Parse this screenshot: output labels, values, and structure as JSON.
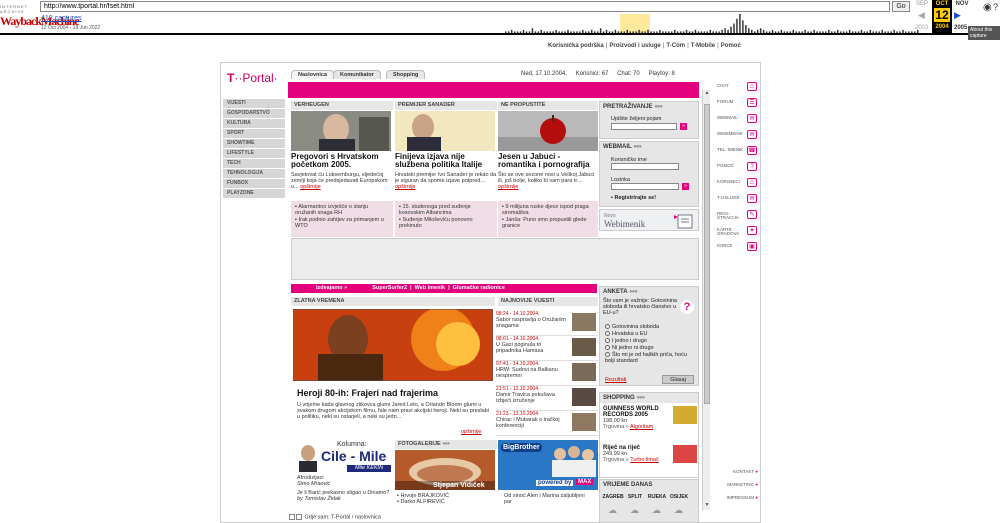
{
  "wayback": {
    "brand_small": "INTERNET ARCHIVE",
    "brand_big_a": "Wayback",
    "brand_big_b": "Machine",
    "url": "http://www.tportal.hr/fset.html",
    "go_label": "Go",
    "captures": "410 captures",
    "range": "12 Oct 2004 - 18 Jun 2022",
    "month_prev": "SEP",
    "month_cur": "OCT",
    "month_next": "NOV",
    "day": "12",
    "year_prev": "2003",
    "year_cur": "2004",
    "year_next": "2005",
    "about": "About this capture",
    "histogram": [
      1,
      1,
      2,
      1,
      1,
      1,
      2,
      1,
      1,
      3,
      1,
      1,
      2,
      1,
      1,
      1,
      1,
      2,
      1,
      1,
      1,
      2,
      1,
      1,
      1,
      1,
      2,
      1,
      1,
      2,
      1,
      1,
      3,
      1,
      2,
      1,
      1,
      2,
      1,
      1,
      1,
      2,
      1,
      1,
      1,
      2,
      1,
      1,
      2,
      1,
      1,
      1,
      2,
      1,
      1,
      1,
      1,
      2,
      1,
      1,
      1,
      2,
      1,
      1,
      2,
      1,
      1,
      1,
      1,
      2,
      1,
      1,
      1,
      2,
      3,
      2,
      4,
      6,
      9,
      12,
      8,
      5,
      3,
      2,
      1,
      2,
      3,
      2,
      1,
      1,
      2,
      1,
      1,
      2,
      1,
      1,
      1,
      2,
      1,
      1,
      1,
      2,
      1,
      1,
      2,
      1,
      1,
      1,
      1,
      2,
      1,
      1,
      2,
      1,
      1,
      1,
      2,
      1,
      1,
      1,
      2,
      1,
      1,
      2,
      1,
      1,
      1,
      2,
      1,
      1,
      1,
      2,
      1,
      1,
      2,
      1,
      1,
      1,
      1,
      2
    ]
  },
  "toplinks": [
    "Korisnička podrška",
    "Proizvodi i usluge",
    "T-Com",
    "T-Mobile",
    "Pomoć"
  ],
  "logo": {
    "t": "T",
    "rest": "··Portal·"
  },
  "tabs": [
    "Naslovnica",
    "Komunikator",
    "Shopping"
  ],
  "status": {
    "date": "Ned, 17.10.2004.",
    "korisnici": "Korisnici: 67",
    "chat": "Chat: 70",
    "playtoy": "Playtoy: 8"
  },
  "leftnav": [
    "VIJESTI",
    "GOSPODARSTVO",
    "KULTURA",
    "SPORT",
    "SHOWTIME",
    "LIFESTYLE",
    "TECH",
    "TEHNOLOGIJA",
    "FUNBOX",
    "PLAYZONE"
  ],
  "news": [
    {
      "head": "VERHEUGEN",
      "title": "Pregovori s Hrvatskom početkom 2005.",
      "text": "Savjetovat ću Luksemburgu, sljedećoj zemlji koja će predsjedavati Europskom u...",
      "more": "opširnije",
      "links": [
        "Alarmantno izvješće o stanju oružanih snaga RH",
        "Irak podnio zahtjev za primanjem u WTO"
      ]
    },
    {
      "head": "PREMIJER SANADER",
      "title": "Finijeva izjava nije službena politika Italije",
      "text": "Hrvatski premijer Ivo Sanader je rekao da je siguran da spome izjave potpred...",
      "more": "opširnije",
      "links": [
        "15. studenoga pred suđenje kosovskim Albancima",
        "Suđenje Miloševiću ponovno prekinuto"
      ]
    },
    {
      "head": "NE PROPUSTITE",
      "title": "Jesen u Jabuci - romantika i pornografija",
      "text": "Što se ove sezone nosi u Velikoj Jabuci ili, još bolje, koliko bi vam para tr...",
      "more": "opširnije",
      "links": [
        "9 milijuna ruske djece ispod praga siromaštva",
        "Janša: Puno smo propustili glede granice"
      ]
    }
  ],
  "search": {
    "head": "PRETRAŽIVANJE",
    "label": "Upišite željeni pojam",
    "go": "»"
  },
  "webmail": {
    "head": "WEBMAIL",
    "user_label": "Korisničko ime",
    "pass_label": "Lozinka",
    "register": "Registrirajte se!",
    "go": "»"
  },
  "webmenik": {
    "a": "Novo",
    "b": "Webimenik"
  },
  "pinkbar2": {
    "a": "Izdvajamo »",
    "b": "SuperSurfer2",
    "c": "Web imenik",
    "d": "Glumačke radionice",
    "sep": "|"
  },
  "zlatna": {
    "head": "ZLATNA VREMENA",
    "title": "Heroji 80-ih: Frajeri nad frajerima",
    "text": "U vrijeme kada glavnog zlikovca glumi Jared Leto, a Orlando Bloom glumi u svakom drugom akcijskom filmu, fale nam pravi akcijski heroji. Neki su preslabi u politiku, neki su ostarjeli, a neki su jedn...",
    "more": "opširnije"
  },
  "najnovije": {
    "head": "NAJNOVIJE VIJESTI",
    "items": [
      {
        "date": "08:24 - 14.10.2004.",
        "text": "Sabor raspravlja o Oružanim snagama"
      },
      {
        "date": "08:01 - 14.10.2004.",
        "text": "U Gazi poginula tri pripadnika Hamasa"
      },
      {
        "date": "07:41 - 14.10.2004.",
        "text": "HRW: Sudovi na Balkanu nespremni"
      },
      {
        "date": "21:51 - 13.10.2004.",
        "text": "Damir Travica pokušava izbjeći izručenje"
      },
      {
        "date": "21:23 - 13.10.2004.",
        "text": "Chirac i Mubarak o iračkoj konferenciji"
      }
    ]
  },
  "kolumna": {
    "label": "Kolumna:",
    "name": "Cile - Mile",
    "author": "Mile KEKIN",
    "t1": "Afrodizijaci",
    "t1b": "Simo Mraović",
    "t2": "Je li Barić prekasno stigao u Dinamo?",
    "t2b": "by Tomislav Židak"
  },
  "fotogal": {
    "head": "FOTOGALERIJE",
    "caption": "Stjepan Vidiček",
    "items": [
      "Hrvoje BRAJKOVIĆ",
      "Darko ALFIREVIĆ"
    ]
  },
  "bigbrother": {
    "logo": "BigBrother",
    "powered": "powered by",
    "max": "MAX",
    "text": "Od sinoć Alen i Marina zaljubljeni par"
  },
  "anketa": {
    "head": "ANKETA",
    "question": "Što vam je važnije: Gotovinina sloboda ili hrvatsko članstvo u EU-u?",
    "options": [
      "Gotovinina sloboda",
      "Hrvatska u EU",
      "I jedno i drugo",
      "Ni jedno ni drugo",
      "Što mi je od haških priča, hoću bolji standard"
    ],
    "results": "Rezultati",
    "vote": "Glasaj"
  },
  "shopping": {
    "head": "SHOPPING",
    "items": [
      {
        "name": "GUINNESS WORLD RECORDS 2005",
        "price": "198,00 kn",
        "store_label": "Trgovina »",
        "store": "Algoritam"
      },
      {
        "name": "Riječ na riječ",
        "price": "249,99 kn",
        "store_label": "Trgovina »",
        "store": "Turbo limač"
      }
    ]
  },
  "vrijeme": {
    "head": "VRIJEME DANAS",
    "cities": [
      "ZAGREB",
      "SPLIT",
      "RIJEKA",
      "OSIJEK"
    ]
  },
  "footer": {
    "label": "Gdje sam:",
    "path": "T-Portal / naslovnica"
  },
  "rightnav": [
    {
      "label": "CHAT",
      "icon": "☺"
    },
    {
      "label": "FORUM",
      "icon": "☰"
    },
    {
      "label": "WEBMAIL",
      "icon": "✉"
    },
    {
      "label": "WEBIMENIK",
      "icon": "✉"
    },
    {
      "label": "TEL. IMENIK",
      "icon": "☎"
    },
    {
      "label": "POMOĆ",
      "icon": "?"
    },
    {
      "label": "KORISNICI",
      "icon": "☺"
    },
    {
      "label": "T-USLUGE",
      "icon": "✉"
    },
    {
      "label": "REGI-STRACIJA",
      "icon": "✎"
    },
    {
      "label": "KARTE GRADOVA",
      "icon": "✦"
    },
    {
      "label": "IGRICE",
      "icon": "▣"
    }
  ],
  "rightbottom": [
    "KONTAKT",
    "MARKETING",
    "IMPRESSUM"
  ]
}
